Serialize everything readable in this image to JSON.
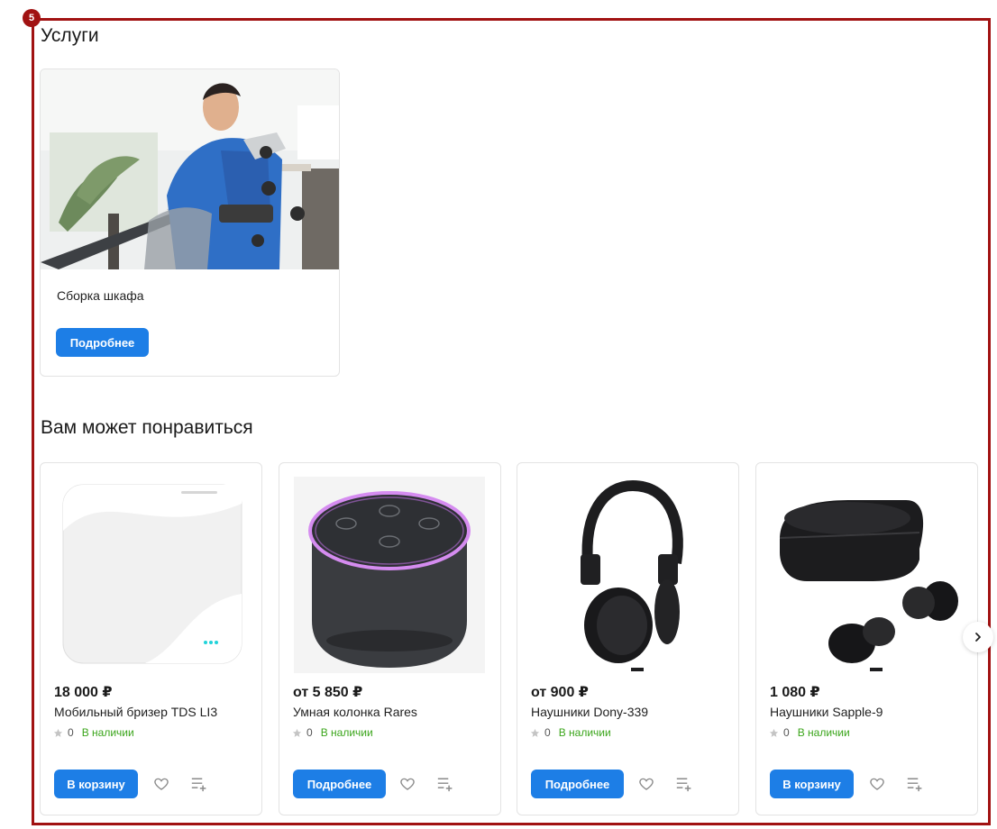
{
  "frame": {
    "badge": "5"
  },
  "services": {
    "title": "Услуги",
    "cards": [
      {
        "name": "Сборка шкафа",
        "button": "Подробнее"
      }
    ]
  },
  "recommendations": {
    "title": "Вам может понравиться",
    "products": [
      {
        "price": "18 000 ₽",
        "name": "Мобильный бризер TDS LI3",
        "rating": "0",
        "stock": "В наличии",
        "button": "В корзину"
      },
      {
        "price": "от 5 850 ₽",
        "name": "Умная колонка Rares",
        "rating": "0",
        "stock": "В наличии",
        "button": "Подробнее"
      },
      {
        "price": "от 900 ₽",
        "name": "Наушники Dony-339",
        "rating": "0",
        "stock": "В наличии",
        "button": "Подробнее"
      },
      {
        "price": "1 080 ₽",
        "name": "Наушники Sapple-9",
        "rating": "0",
        "stock": "В наличии",
        "button": "В корзину"
      }
    ]
  },
  "icons": {
    "star": "star-icon",
    "favorite": "heart-icon",
    "compare": "compare-list-icon",
    "next": "chevron-right-icon"
  },
  "colors": {
    "accent": "#1d7ee6",
    "in_stock": "#3aa51a",
    "frame": "#a11212",
    "star": "#c4c4c4"
  }
}
